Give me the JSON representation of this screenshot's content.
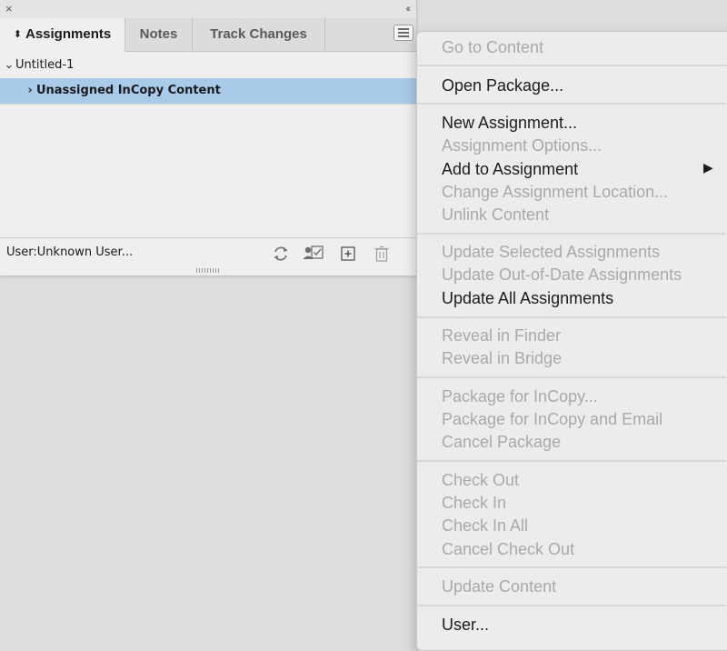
{
  "panel": {
    "close_glyph": "×",
    "collapse_glyph": "‹‹",
    "tabs": [
      {
        "label": "Assignments",
        "active": true
      },
      {
        "label": "Notes",
        "active": false
      },
      {
        "label": "Track Changes",
        "active": false
      }
    ],
    "tree": {
      "document": "Untitled-1",
      "item": "Unassigned InCopy Content"
    },
    "footer": {
      "user_label": "User:Unknown User...",
      "icons": [
        "refresh-icon",
        "user-check-icon",
        "add-icon",
        "trash-icon"
      ]
    }
  },
  "context_menu": {
    "items": [
      {
        "label": "Go to Content",
        "enabled": false
      },
      {
        "label": "Open Package...",
        "enabled": true
      },
      {
        "label": "New Assignment...",
        "enabled": true
      },
      {
        "label": "Assignment Options...",
        "enabled": false
      },
      {
        "label": "Add to Assignment",
        "enabled": true,
        "submenu": true
      },
      {
        "label": "Change Assignment Location...",
        "enabled": false
      },
      {
        "label": "Unlink Content",
        "enabled": false
      },
      {
        "label": "Update Selected Assignments",
        "enabled": false
      },
      {
        "label": "Update Out-of-Date Assignments",
        "enabled": false
      },
      {
        "label": "Update All Assignments",
        "enabled": true
      },
      {
        "label": "Reveal in Finder",
        "enabled": false
      },
      {
        "label": "Reveal in Bridge",
        "enabled": false
      },
      {
        "label": "Package for InCopy...",
        "enabled": false
      },
      {
        "label": "Package for InCopy and Email",
        "enabled": false
      },
      {
        "label": "Cancel Package",
        "enabled": false
      },
      {
        "label": "Check Out",
        "enabled": false
      },
      {
        "label": "Check In",
        "enabled": false
      },
      {
        "label": "Check In All",
        "enabled": false
      },
      {
        "label": "Cancel Check Out",
        "enabled": false
      },
      {
        "label": "Update Content",
        "enabled": false
      },
      {
        "label": "User...",
        "enabled": true
      }
    ]
  },
  "colors": {
    "selected_row": "#a9cbea",
    "disabled_text": "#a9a9a9",
    "enabled_text": "#1c1c1c"
  }
}
